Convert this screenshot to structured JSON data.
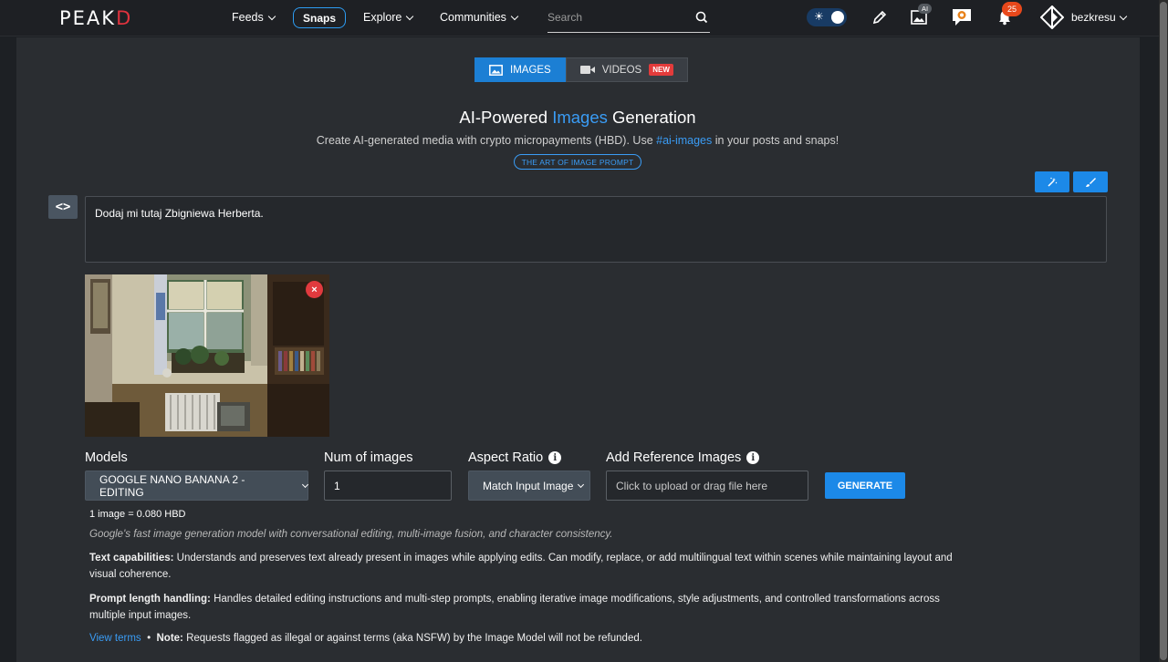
{
  "nav": {
    "logo_main": "PEAK",
    "logo_end": "D",
    "feeds": "Feeds",
    "snaps": "Snaps",
    "explore": "Explore",
    "communities": "Communities",
    "search_placeholder": "Search",
    "ai_badge": "AI",
    "notifications_count": "25",
    "username": "bezkresu"
  },
  "tabs": {
    "images": "IMAGES",
    "videos": "VIDEOS",
    "new_badge": "NEW"
  },
  "header": {
    "title_pre": "AI-Powered ",
    "title_hl": "Images",
    "title_post": " Generation",
    "subtitle_pre": "Create AI-generated media with crypto micropayments (HBD). Use ",
    "subtitle_tag": "#ai-images",
    "subtitle_post": " in your posts and snaps!",
    "art_prompt": "THE ART OF IMAGE PROMPT"
  },
  "prompt": {
    "value": "Dodaj mi tutaj Zbigniewa Herberta."
  },
  "form": {
    "models_label": "Models",
    "model_value": "GOOGLE NANO BANANA 2 - EDITING",
    "num_label": "Num of images",
    "num_value": "1",
    "aspect_label": "Aspect Ratio",
    "aspect_value": "Match Input Image",
    "ref_label": "Add Reference Images",
    "upload_text": "Click to upload or drag file here",
    "generate": "GENERATE"
  },
  "info": {
    "cost": "1 image = 0.080 HBD",
    "description": "Google's fast image generation model with conversational editing, multi-image fusion, and character consistency.",
    "text_cap_label": "Text capabilities:",
    "text_cap_body": " Understands and preserves text already present in images while applying edits. Can modify, replace, or add multilingual text within scenes while maintaining layout and visual coherence.",
    "prompt_len_label": "Prompt length handling:",
    "prompt_len_body": " Handles detailed editing instructions and multi-step prompts, enabling iterative image modifications, style adjustments, and controlled transformations across multiple input images.",
    "view_terms": "View terms",
    "bullet": "•",
    "note_label": "Note:",
    "note_body": " Requests flagged as illegal or against terms (aka NSFW) by the Image Model will not be refunded."
  },
  "colors": {
    "accent": "#1c89e8",
    "brand_red": "#e0333e",
    "background": "#2a2d31"
  }
}
